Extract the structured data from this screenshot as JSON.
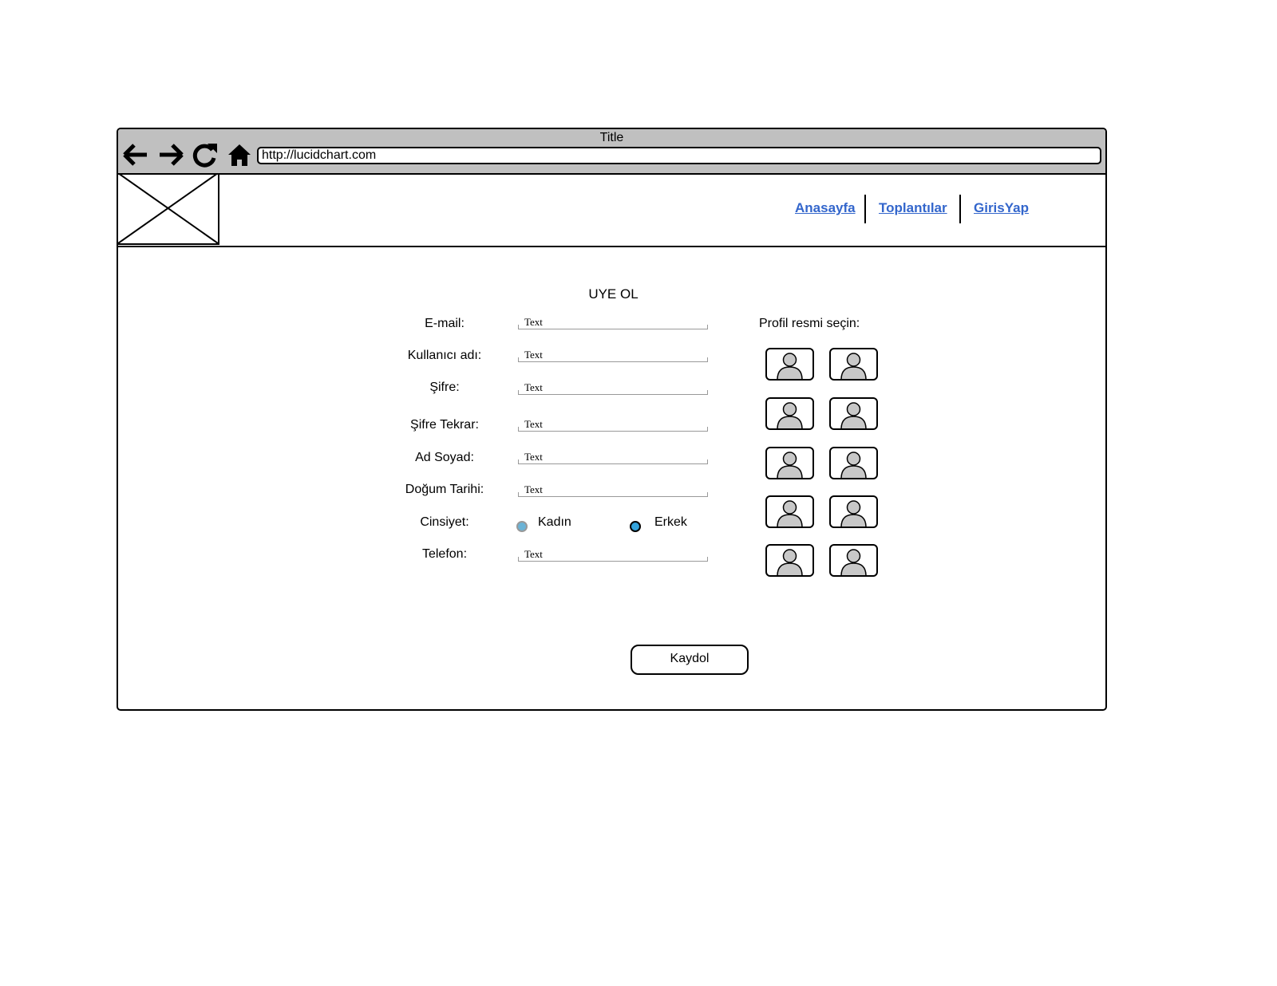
{
  "window": {
    "title": "Title",
    "url": "http://lucidchart.com"
  },
  "toolbar": {
    "icons": [
      "back-arrow-icon",
      "forward-arrow-icon",
      "refresh-icon",
      "home-icon"
    ]
  },
  "nav": {
    "links": [
      "Anasayfa",
      "Toplantılar",
      "GirisYap"
    ],
    "link_color": "#3366cc"
  },
  "form": {
    "title": "UYE OL",
    "fields": [
      {
        "label": "E-mail:",
        "value": "Text"
      },
      {
        "label": "Kullanıcı adı:",
        "value": "Text"
      },
      {
        "label": "Şifre:",
        "value": "Text"
      },
      {
        "label": "Şifre Tekrar:",
        "value": "Text"
      },
      {
        "label": "Ad Soyad:",
        "value": "Text"
      },
      {
        "label": "Doğum Tarihi:",
        "value": "Text"
      },
      {
        "label": "Telefon:",
        "value": "Text"
      }
    ],
    "gender": {
      "label": "Cinsiyet:",
      "options": [
        "Kadın",
        "Erkek"
      ]
    },
    "profile": {
      "label": "Profil resmi seçin:",
      "avatar_icon": "user-avatar-icon",
      "count": 10
    },
    "submit_label": "Kaydol"
  },
  "colors": {
    "chrome": "#c0c0c0",
    "radio_selected": "#33a3dc",
    "radio_unselected": "#6bb3d6",
    "avatar_fill": "#c8c8c8"
  }
}
